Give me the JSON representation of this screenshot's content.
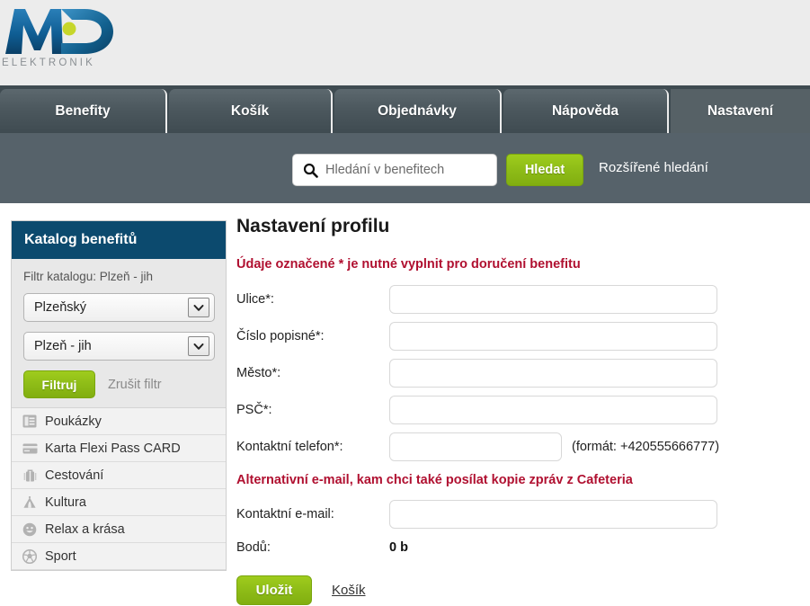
{
  "brand": {
    "logo_text": "MD",
    "logo_subtitle": "ELEKTRONIK",
    "logo_blue": "#0d5b8f",
    "logo_dot": "#c6d62b"
  },
  "nav": {
    "tabs": [
      {
        "label": "Benefity",
        "active": false
      },
      {
        "label": "Košík",
        "active": false
      },
      {
        "label": "Objednávky",
        "active": false
      },
      {
        "label": "Nápověda",
        "active": false
      },
      {
        "label": "Nastavení",
        "active": true
      }
    ]
  },
  "search": {
    "icon": "search-icon",
    "placeholder": "Hledání v benefitech",
    "value": "",
    "button_label": "Hledat",
    "advanced_link": "Rozšířené hledání",
    "button_color": "#8ebc17"
  },
  "sidebar": {
    "title": "Katalog benefitů",
    "title_bg": "#0c4a6e",
    "filter_label": "Filtr katalogu: Plzeň - jih",
    "region_select": {
      "value": "Plzeňský",
      "icon": "chevron-down-icon"
    },
    "district_select": {
      "value": "Plzeň - jih",
      "icon": "chevron-down-icon"
    },
    "filter_button": "Filtruj",
    "clear_filter_link": "Zrušit filtr",
    "items": [
      {
        "label": "Poukázky",
        "icon": "voucher-icon"
      },
      {
        "label": "Karta Flexi Pass CARD",
        "icon": "card-icon"
      },
      {
        "label": "Cestování",
        "icon": "suitcase-icon"
      },
      {
        "label": "Kultura",
        "icon": "theater-icon"
      },
      {
        "label": "Relax a krása",
        "icon": "smiley-icon"
      },
      {
        "label": "Sport",
        "icon": "ball-icon"
      }
    ]
  },
  "main": {
    "title": "Nastavení profilu",
    "required_note": "Údaje označené * je nutné vyplnit pro doručení benefitu",
    "fields": [
      {
        "label": "Ulice*:",
        "value": "",
        "name": "street-field"
      },
      {
        "label": "Číslo popisné*:",
        "value": "",
        "name": "house-number-field"
      },
      {
        "label": "Město*:",
        "value": "",
        "name": "city-field"
      },
      {
        "label": "PSČ*:",
        "value": "",
        "name": "postal-code-field"
      }
    ],
    "phone": {
      "label": "Kontaktní telefon*:",
      "value": "",
      "hint": "(formát: +420555666777)"
    },
    "alt_email_note": "Alternativní e-mail, kam chci také posílat kopie zpráv z Cafeteria",
    "email": {
      "label": "Kontaktní e-mail:",
      "value": ""
    },
    "points": {
      "label": "Bodů:",
      "value": "0 b"
    },
    "save_button": "Uložit",
    "cart_link": "Košík",
    "note_color": "#b01030"
  }
}
